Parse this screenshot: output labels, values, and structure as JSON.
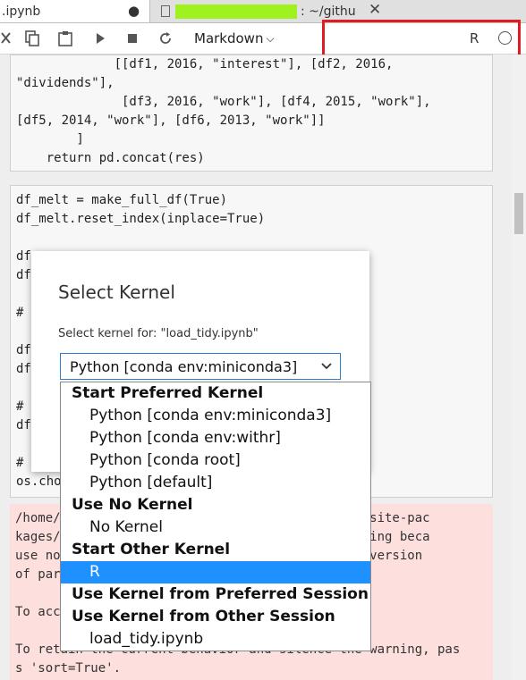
{
  "tabs": {
    "active_label": ".ipynb",
    "active_dirty_marker": "●",
    "other_label": ": ~/githu",
    "other_close": "✕"
  },
  "toolbar": {
    "cell_type": "Markdown",
    "kernel_name": "R"
  },
  "code_cells": {
    "cell1": [
      "             [[df1, 2016, \"interest\"], [df2, 2016,",
      "\"dividends\"],",
      "              [df3, 2016, \"work\"], [df4, 2015, \"work\"],",
      "[df5, 2014, \"work\"], [df6, 2013, \"work\"]]",
      "        ]",
      "    return pd.concat(res)"
    ],
    "cell2": [
      "df_melt = make_full_df(True)",
      "df_melt.reset_index(inplace=True)",
      "",
      "df",
      "df",
      "",
      "#",
      "",
      "df",
      "df",
      "",
      "#",
      "df",
      "",
      "#",
      "os.cho"
    ]
  },
  "output_cell": [
    "/home/                                  hon3.6/site-pac",
    "kages/                                  g: Sorting beca",
    "use no                                  future version",
    "of par",
    "",
    "To acc                                  ise'.",
    "",
    "To retain the current behavior and silence the warning, pas",
    "s 'sort=True'."
  ],
  "dialog": {
    "title": "Select Kernel",
    "label": "Select kernel for: \"load_tidy.ipynb\"",
    "selected_value": "Python [conda env:miniconda3]"
  },
  "dropdown": {
    "groups": [
      {
        "label": "Start Preferred Kernel",
        "options": [
          "Python [conda env:miniconda3]",
          "Python [conda env:withr]",
          "Python [conda root]",
          "Python [default]"
        ]
      },
      {
        "label": "Use No Kernel",
        "options": [
          "No Kernel"
        ]
      },
      {
        "label": "Start Other Kernel",
        "options": [
          "R"
        ]
      },
      {
        "label": "Use Kernel from Preferred Session",
        "options": []
      },
      {
        "label": "Use Kernel from Other Session",
        "options": [
          "load_tidy.ipynb"
        ]
      }
    ],
    "highlighted_option": "R"
  },
  "icons": {
    "cut": "cut-icon",
    "copy": "copy-icon",
    "paste": "paste-icon",
    "run": "run-icon",
    "stop": "stop-icon",
    "restart": "restart-icon"
  },
  "colors": {
    "selection": "#1e90ff",
    "annotation_box": "#e01b24",
    "error_output_bg": "#fddfdd"
  }
}
